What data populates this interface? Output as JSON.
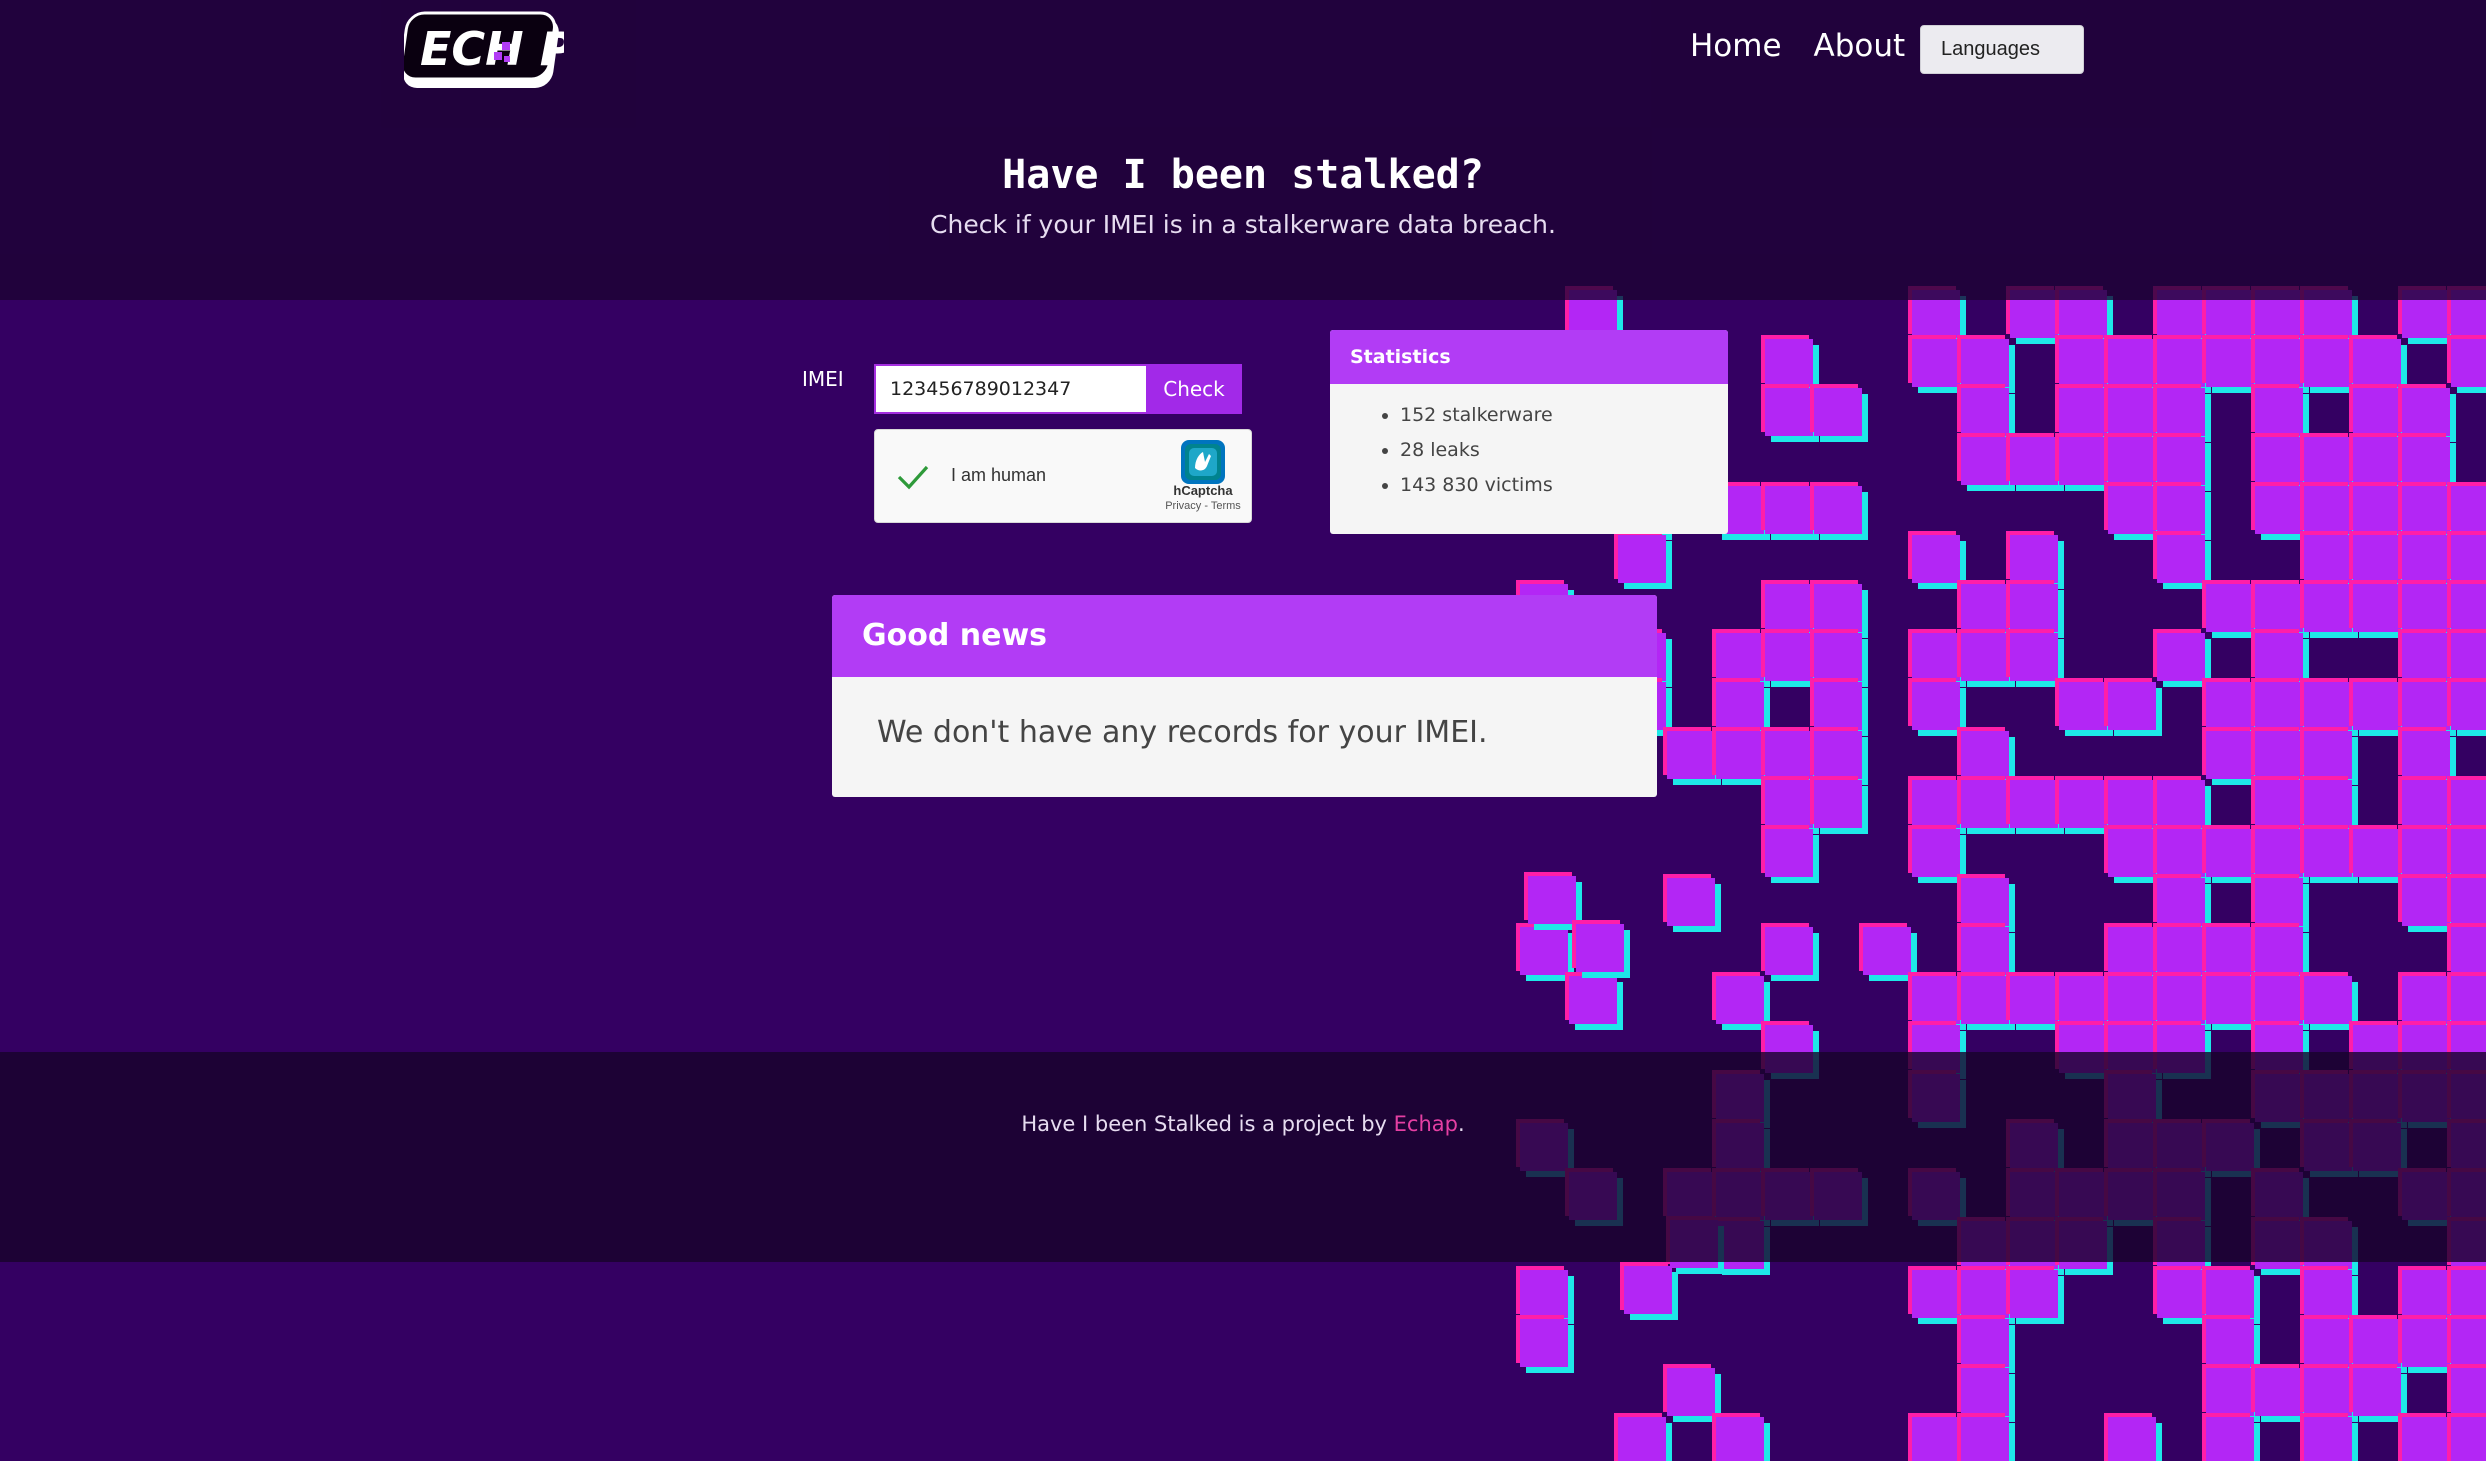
{
  "header": {
    "logo_text": "ECH P",
    "nav": [
      {
        "label": "Home"
      },
      {
        "label": "About"
      }
    ],
    "languages_label": "Languages"
  },
  "hero": {
    "title": "Have I been stalked?",
    "subtitle": "Check if your IMEI is in a stalkerware data breach."
  },
  "form": {
    "imei_label": "IMEI",
    "imei_value": "123456789012347",
    "check_label": "Check",
    "captcha": {
      "label": "I am human",
      "brand": "hCaptcha",
      "privacy": "Privacy",
      "separator": " - ",
      "terms": "Terms",
      "checked": true
    }
  },
  "statistics": {
    "title": "Statistics",
    "items": [
      "152 stalkerware",
      "28 leaks",
      "143 830 victims"
    ]
  },
  "result": {
    "title": "Good news",
    "message": "We don't have any records for your IMEI."
  },
  "footer": {
    "prefix": "Have I been Stalked is a project by ",
    "link": "Echap",
    "suffix": "."
  },
  "colors": {
    "background": "#340062",
    "accent": "#b23cf5",
    "button": "#a229e8",
    "pixel_magenta": "#ff1ea8",
    "pixel_cyan": "#1ee8e8",
    "pixel_purple": "#b326f5",
    "footer_link": "#e53fa3"
  }
}
